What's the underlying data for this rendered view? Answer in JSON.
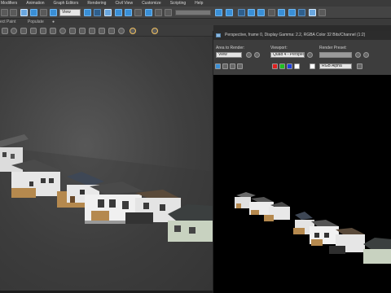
{
  "menubar": {
    "items": [
      "Modifiers",
      "Animation",
      "Graph Editors",
      "Rendering",
      "Civil View",
      "Customize",
      "Scripting",
      "Help"
    ]
  },
  "toolbar": {
    "selection_filter": "View",
    "named_selection": ""
  },
  "secondary_bar": {
    "left_text": "ect Paint",
    "populate": "Populate"
  },
  "render_frame": {
    "title": "Perspective, frame 0, Display Gamma: 2.2, RGBA Color 32 Bits/Channel (1:2)",
    "area_label": "Area to Render:",
    "area_value": "View",
    "viewport_label": "Viewport:",
    "viewport_value": "Quad 4 - Perspec",
    "preset_label": "Render Preset:",
    "preset_value": "",
    "channel_value": "RGB Alpha"
  },
  "colors": {
    "accent": "#3a8fd6",
    "viewport_bg": "#474747",
    "render_bg": "#000000",
    "swatch_red": "#e02020",
    "swatch_green": "#20c020",
    "swatch_blue": "#2040e0"
  },
  "icons": [
    "undo-icon",
    "redo-icon",
    "link-icon",
    "select-icon",
    "move-icon",
    "rotate-icon",
    "scale-icon",
    "render-setup-icon",
    "render-frame-icon",
    "render-icon",
    "lock-icon",
    "save-image-icon",
    "clone-icon",
    "print-icon"
  ]
}
